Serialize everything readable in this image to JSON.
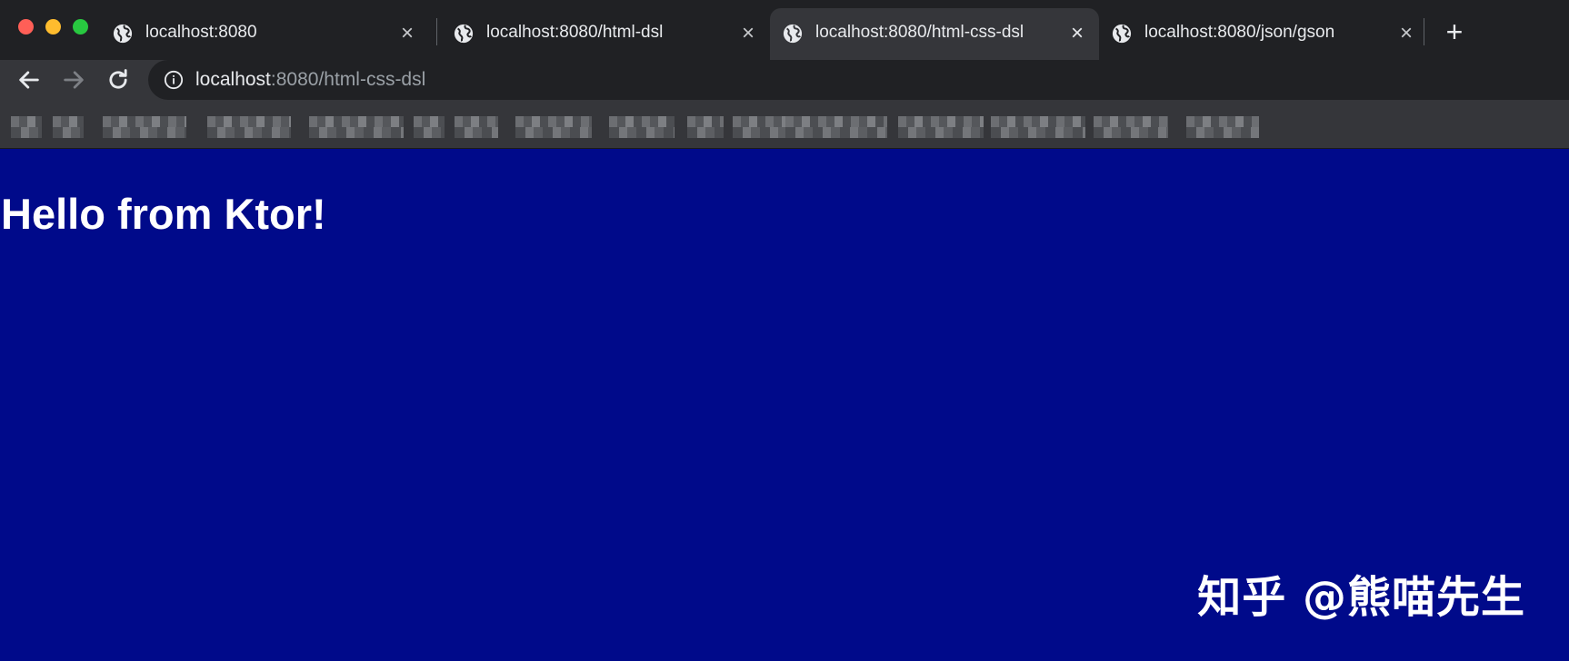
{
  "window": {
    "controls": [
      "close",
      "minimize",
      "zoom"
    ]
  },
  "tabs": [
    {
      "title": "localhost:8080",
      "icon": "globe-icon",
      "active": false
    },
    {
      "title": "localhost:8080/html-dsl",
      "icon": "globe-icon",
      "active": false
    },
    {
      "title": "localhost:8080/html-css-dsl",
      "icon": "globe-icon",
      "active": true
    },
    {
      "title": "localhost:8080/json/gson",
      "icon": "globe-icon",
      "active": false
    }
  ],
  "toolbar": {
    "back_icon": "arrow-left-icon",
    "forward_icon": "arrow-right-icon",
    "reload_icon": "reload-icon",
    "url_host": "localhost",
    "url_rest": ":8080/html-css-dsl"
  },
  "page": {
    "heading": "Hello from Ktor!",
    "background_color": "#000a8a"
  },
  "watermark": "知乎 @熊喵先生"
}
